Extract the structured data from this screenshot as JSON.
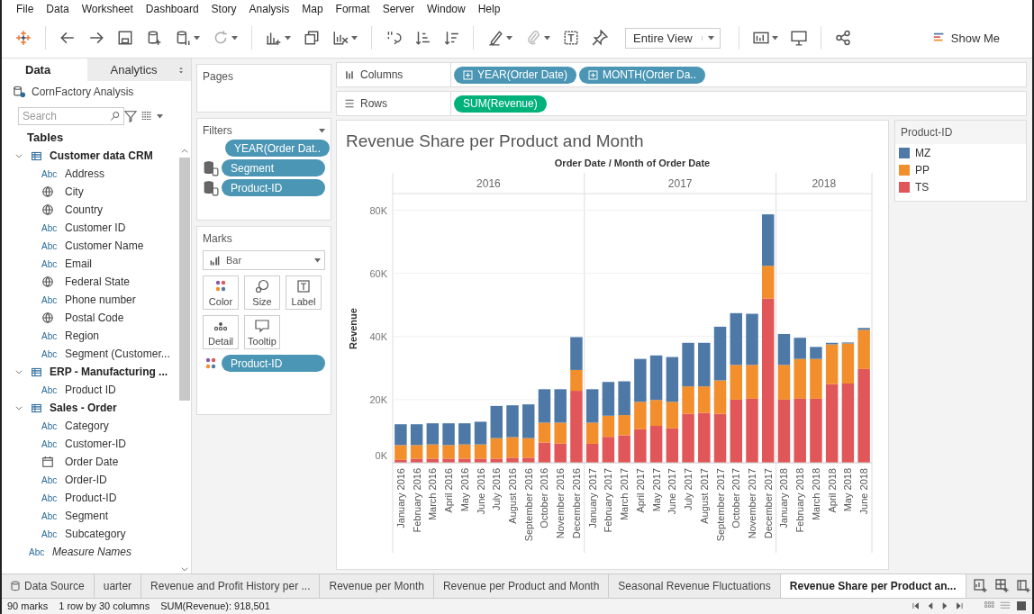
{
  "menu": [
    "File",
    "Data",
    "Worksheet",
    "Dashboard",
    "Story",
    "Analysis",
    "Map",
    "Format",
    "Server",
    "Window",
    "Help"
  ],
  "toolbar": {
    "view_mode": "Entire View",
    "show_me": "Show Me"
  },
  "data_pane": {
    "tabs": [
      {
        "label": "Data",
        "selected": true
      },
      {
        "label": "Analytics",
        "selected": false
      }
    ],
    "data_source": "CornFactory Analysis",
    "search": {
      "placeholder": "Search"
    },
    "heading": "Tables",
    "tables": [
      {
        "name": "Customer data CRM",
        "expanded": true,
        "children": [
          {
            "kind": "text",
            "badge": "Abc",
            "name": "Address"
          },
          {
            "kind": "geo",
            "name": "City"
          },
          {
            "kind": "geo",
            "name": "Country"
          },
          {
            "kind": "text",
            "badge": "Abc",
            "name": "Customer ID"
          },
          {
            "kind": "text",
            "badge": "Abc",
            "name": "Customer Name"
          },
          {
            "kind": "text",
            "badge": "Abc",
            "name": "Email"
          },
          {
            "kind": "geo",
            "name": "Federal State"
          },
          {
            "kind": "text",
            "badge": "Abc",
            "name": "Phone number"
          },
          {
            "kind": "geo",
            "name": "Postal Code"
          },
          {
            "kind": "text",
            "badge": "Abc",
            "name": "Region"
          },
          {
            "kind": "text",
            "badge": "Abc",
            "name": "Segment (Customer..."
          }
        ]
      },
      {
        "name": "ERP - Manufacturing ...",
        "expanded": true,
        "children": [
          {
            "kind": "text",
            "badge": "Abc",
            "name": "Product ID"
          }
        ]
      },
      {
        "name": "Sales - Order",
        "expanded": true,
        "children": [
          {
            "kind": "text",
            "badge": "Abc",
            "name": "Category"
          },
          {
            "kind": "text",
            "badge": "Abc",
            "name": "Customer-ID"
          },
          {
            "kind": "date",
            "name": "Order Date"
          },
          {
            "kind": "text",
            "badge": "Abc",
            "name": "Order-ID"
          },
          {
            "kind": "text",
            "badge": "Abc",
            "name": "Product-ID"
          },
          {
            "kind": "text",
            "badge": "Abc",
            "name": "Segment"
          },
          {
            "kind": "text",
            "badge": "Abc",
            "name": "Subcategory"
          }
        ]
      }
    ],
    "extra_fields": [
      {
        "kind": "measure",
        "badge": "Abc",
        "name": "Measure Names"
      }
    ]
  },
  "pages": {
    "title": "Pages"
  },
  "filters": {
    "title": "Filters",
    "pills": [
      {
        "label": "YEAR(Order Dat..",
        "linked": false
      },
      {
        "label": "Segment",
        "linked": true
      },
      {
        "label": "Product-ID",
        "linked": true
      }
    ]
  },
  "marks": {
    "title": "Marks",
    "mark_type": "Bar",
    "buttons": [
      {
        "kind": "color",
        "label": "Color"
      },
      {
        "kind": "size",
        "label": "Size"
      },
      {
        "kind": "label",
        "label": "Label"
      },
      {
        "kind": "detail",
        "label": "Detail"
      },
      {
        "kind": "tooltip",
        "label": "Tooltip"
      }
    ],
    "pills": [
      {
        "kind": "color",
        "label": "Product-ID"
      }
    ]
  },
  "shelves": [
    {
      "kind": "columns",
      "label": "Columns",
      "pills": [
        {
          "label": "YEAR(Order Date)",
          "kind": "discrete"
        },
        {
          "label": "MONTH(Order Da..",
          "kind": "discrete"
        }
      ]
    },
    {
      "kind": "rows",
      "label": "Rows",
      "pills": [
        {
          "label": "SUM(Revenue)",
          "kind": "continuous"
        }
      ]
    }
  ],
  "chart": {
    "year_headers": [
      {
        "label": "2016"
      },
      {
        "label": "2017"
      },
      {
        "label": "2018"
      }
    ],
    "chart_data": {
      "type": "bar",
      "stacked": true,
      "grid": true,
      "title": "Revenue Share per Product and Month",
      "xlabel": "Order Date / Month of Order Date",
      "ylabel": "Revenue",
      "categories": [
        "January 2016",
        "February 2016",
        "March 2016",
        "April 2016",
        "May 2016",
        "June 2016",
        "July 2016",
        "August 2016",
        "September 2016",
        "October 2016",
        "November 2016",
        "December 2016",
        "January 2017",
        "February 2017",
        "March 2017",
        "April 2017",
        "May 2017",
        "June 2017",
        "July 2017",
        "August 2017",
        "September 2017",
        "October 2017",
        "November 2017",
        "December 2017",
        "January 2018",
        "February 2018",
        "March 2018",
        "April 2018",
        "May 2018",
        "June 2018"
      ],
      "ylim": [
        0,
        85
      ],
      "yticks": [
        {
          "value": 0,
          "label": "0K"
        },
        {
          "value": 20,
          "label": "20K"
        },
        {
          "value": 40,
          "label": "40K"
        },
        {
          "value": 60,
          "label": "60K"
        },
        {
          "value": 80,
          "label": "80K"
        }
      ],
      "series": [
        {
          "name": "MZ",
          "color": "#4e79a7",
          "values": [
            6.6,
            6.6,
            6.7,
            6.9,
            6.7,
            7.2,
            10.2,
            10.1,
            10.7,
            10.6,
            10.6,
            10.4,
            10.6,
            10.7,
            10.7,
            13.6,
            14.1,
            14.2,
            13.8,
            13.8,
            17.0,
            16.4,
            16.2,
            16.3,
            9.8,
            6.7,
            3.8,
            0.5,
            0.3,
            0.6
          ]
        },
        {
          "name": "PP",
          "color": "#f28e2b",
          "values": [
            4.7,
            4.3,
            4.5,
            4.3,
            4.5,
            4.5,
            6.5,
            6.5,
            6.2,
            6.3,
            6.6,
            6.6,
            6.7,
            6.7,
            6.4,
            8.7,
            8.2,
            8.4,
            8.7,
            8.4,
            10.6,
            11.0,
            10.7,
            10.4,
            11.0,
            12.6,
            12.6,
            12.6,
            12.7,
            12.4
          ]
        },
        {
          "name": "TS",
          "color": "#e15759",
          "values": [
            0.9,
            1.3,
            1.3,
            1.3,
            1.3,
            1.3,
            1.3,
            1.6,
            1.6,
            6.4,
            6.1,
            22.8,
            6.0,
            8.2,
            8.7,
            10.6,
            11.7,
            10.9,
            15.5,
            15.8,
            15.5,
            20.0,
            20.3,
            52.0,
            20.0,
            20.3,
            20.3,
            24.9,
            25.1,
            29.7
          ]
        }
      ]
    }
  },
  "legend": {
    "title": "Product-ID"
  },
  "sheet_tabs": [
    {
      "label": "Data Source",
      "kind": "source",
      "selected": false
    },
    {
      "label": "uarter",
      "kind": "sheet",
      "selected": false
    },
    {
      "label": "Revenue and Profit History per ...",
      "kind": "sheet",
      "selected": false
    },
    {
      "label": "Revenue per Month",
      "kind": "sheet",
      "selected": false
    },
    {
      "label": "Revenue per Product and Month",
      "kind": "sheet",
      "selected": false
    },
    {
      "label": "Seasonal Revenue Fluctuations",
      "kind": "sheet",
      "selected": false
    },
    {
      "label": "Revenue Share per Product an...",
      "kind": "sheet",
      "selected": true
    }
  ],
  "status_bar": [
    "90 marks",
    "1 row by 30 columns",
    "SUM(Revenue): 918,501"
  ]
}
